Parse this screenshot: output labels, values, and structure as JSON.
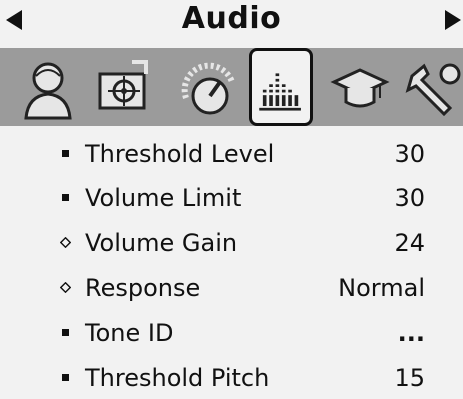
{
  "header": {
    "title": "Audio"
  },
  "icons": [
    {
      "name": "user-profile-icon",
      "selected": false
    },
    {
      "name": "gps-target-icon",
      "selected": false
    },
    {
      "name": "detect-dial-icon",
      "selected": false
    },
    {
      "name": "audio-equalizer-icon",
      "selected": true
    },
    {
      "name": "graduation-cap-icon",
      "selected": false
    },
    {
      "name": "wrench-tools-icon",
      "selected": false
    }
  ],
  "settings": [
    {
      "marker": "bullet",
      "label": "Threshold Level",
      "value": "30"
    },
    {
      "marker": "bullet",
      "label": "Volume Limit",
      "value": "30"
    },
    {
      "marker": "diamond",
      "label": "Volume Gain",
      "value": "24"
    },
    {
      "marker": "diamond",
      "label": "Response",
      "value": "Normal"
    },
    {
      "marker": "bullet",
      "label": "Tone ID",
      "value": "..."
    },
    {
      "marker": "bullet",
      "label": "Threshold Pitch",
      "value": "15"
    }
  ],
  "colors": {
    "background": "#f2f2f2",
    "icon_band": "#9b9b9b",
    "foreground": "#111111"
  }
}
